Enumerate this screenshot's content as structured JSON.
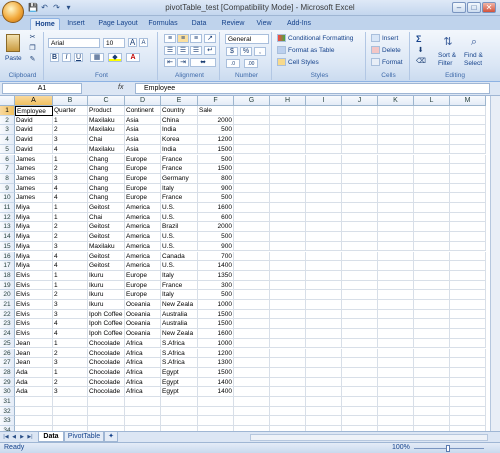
{
  "window": {
    "title": "pivotTable_test  [Compatibility Mode] - Microsoft Excel",
    "min": "–",
    "max": "□",
    "close": "✕"
  },
  "quick_access": [
    "💾",
    "↶",
    "↷",
    "▾"
  ],
  "ribbon_tabs": [
    "Home",
    "Insert",
    "Page Layout",
    "Formulas",
    "Data",
    "Review",
    "View",
    "Add-Ins"
  ],
  "active_tab": "Home",
  "ribbon": {
    "clipboard": {
      "label": "Clipboard",
      "paste": "Paste"
    },
    "font": {
      "label": "Font",
      "name": "Arial",
      "size": "10",
      "bold": "B",
      "italic": "I",
      "underline": "U",
      "grow": "A",
      "shrink": "A"
    },
    "alignment": {
      "label": "Alignment"
    },
    "number": {
      "label": "Number",
      "format": "General",
      "currency": "$",
      "percent": "%",
      "comma": ","
    },
    "styles": {
      "label": "Styles",
      "conditional": "Conditional Formatting",
      "format_table": "Format as Table",
      "cell_styles": "Cell Styles"
    },
    "cells": {
      "label": "Cells",
      "insert": "Insert",
      "delete": "Delete",
      "format": "Format"
    },
    "editing": {
      "label": "Editing",
      "sigma": "Σ",
      "sort": "Sort &",
      "filter": "Filter",
      "find": "Find &",
      "select": "Select"
    }
  },
  "formula_bar": {
    "name_box": "A1",
    "fx": "fx",
    "content": "Employee"
  },
  "columns": [
    "A",
    "B",
    "C",
    "D",
    "E",
    "F",
    "G",
    "H",
    "I",
    "J",
    "K",
    "L",
    "M"
  ],
  "rows": [
    [
      "Employee",
      "Quarter",
      "Product",
      "Continent",
      "Country",
      "Sale"
    ],
    [
      "David",
      "1",
      "Maxilaku",
      "Asia",
      "China",
      "2000"
    ],
    [
      "David",
      "2",
      "Maxilaku",
      "Asia",
      "India",
      "500"
    ],
    [
      "David",
      "3",
      "Chai",
      "Asia",
      "Korea",
      "1200"
    ],
    [
      "David",
      "4",
      "Maxilaku",
      "Asia",
      "India",
      "1500"
    ],
    [
      "James",
      "1",
      "Chang",
      "Europe",
      "France",
      "500"
    ],
    [
      "James",
      "2",
      "Chang",
      "Europe",
      "France",
      "1500"
    ],
    [
      "James",
      "3",
      "Chang",
      "Europe",
      "Germany",
      "800"
    ],
    [
      "James",
      "4",
      "Chang",
      "Europe",
      "Italy",
      "900"
    ],
    [
      "James",
      "4",
      "Chang",
      "Europe",
      "France",
      "500"
    ],
    [
      "Miya",
      "1",
      "Geitost",
      "America",
      "U.S.",
      "1600"
    ],
    [
      "Miya",
      "1",
      "Chai",
      "America",
      "U.S.",
      "600"
    ],
    [
      "Miya",
      "2",
      "Geitost",
      "America",
      "Brazil",
      "2000"
    ],
    [
      "Miya",
      "2",
      "Geitost",
      "America",
      "U.S.",
      "500"
    ],
    [
      "Miya",
      "3",
      "Maxilaku",
      "America",
      "U.S.",
      "900"
    ],
    [
      "Miya",
      "4",
      "Geitost",
      "America",
      "Canada",
      "700"
    ],
    [
      "Miya",
      "4",
      "Geitost",
      "America",
      "U.S.",
      "1400"
    ],
    [
      "Elvis",
      "1",
      "Ikuru",
      "Europe",
      "Italy",
      "1350"
    ],
    [
      "Elvis",
      "1",
      "Ikuru",
      "Europe",
      "France",
      "300"
    ],
    [
      "Elvis",
      "2",
      "Ikuru",
      "Europe",
      "Italy",
      "500"
    ],
    [
      "Elvis",
      "3",
      "Ikuru",
      "Oceania",
      "New Zeala",
      "1000"
    ],
    [
      "Elvis",
      "3",
      "Ipoh Coffee",
      "Oceania",
      "Australia",
      "1500"
    ],
    [
      "Elvis",
      "4",
      "Ipoh Coffee",
      "Oceania",
      "Australia",
      "1500"
    ],
    [
      "Elvis",
      "4",
      "Ipoh Coffee",
      "Oceania",
      "New Zeala",
      "1600"
    ],
    [
      "Jean",
      "1",
      "Chocolade",
      "Africa",
      "S.Africa",
      "1000"
    ],
    [
      "Jean",
      "2",
      "Chocolade",
      "Africa",
      "S.Africa",
      "1200"
    ],
    [
      "Jean",
      "3",
      "Chocolade",
      "Africa",
      "S.Africa",
      "1300"
    ],
    [
      "Ada",
      "1",
      "Chocolade",
      "Africa",
      "Egypt",
      "1500"
    ],
    [
      "Ada",
      "2",
      "Chocolade",
      "Africa",
      "Egypt",
      "1400"
    ],
    [
      "Ada",
      "3",
      "Chocolade",
      "Africa",
      "Egypt",
      "1400"
    ],
    [
      "",
      "",
      "",
      "",
      "",
      ""
    ],
    [
      "",
      "",
      "",
      "",
      "",
      ""
    ],
    [
      "",
      "",
      "",
      "",
      "",
      ""
    ],
    [
      "",
      "",
      "",
      "",
      "",
      ""
    ]
  ],
  "sheets": [
    "Data",
    "PivotTable"
  ],
  "active_sheet": "Data",
  "status": {
    "ready": "Ready",
    "zoom": "100%"
  }
}
